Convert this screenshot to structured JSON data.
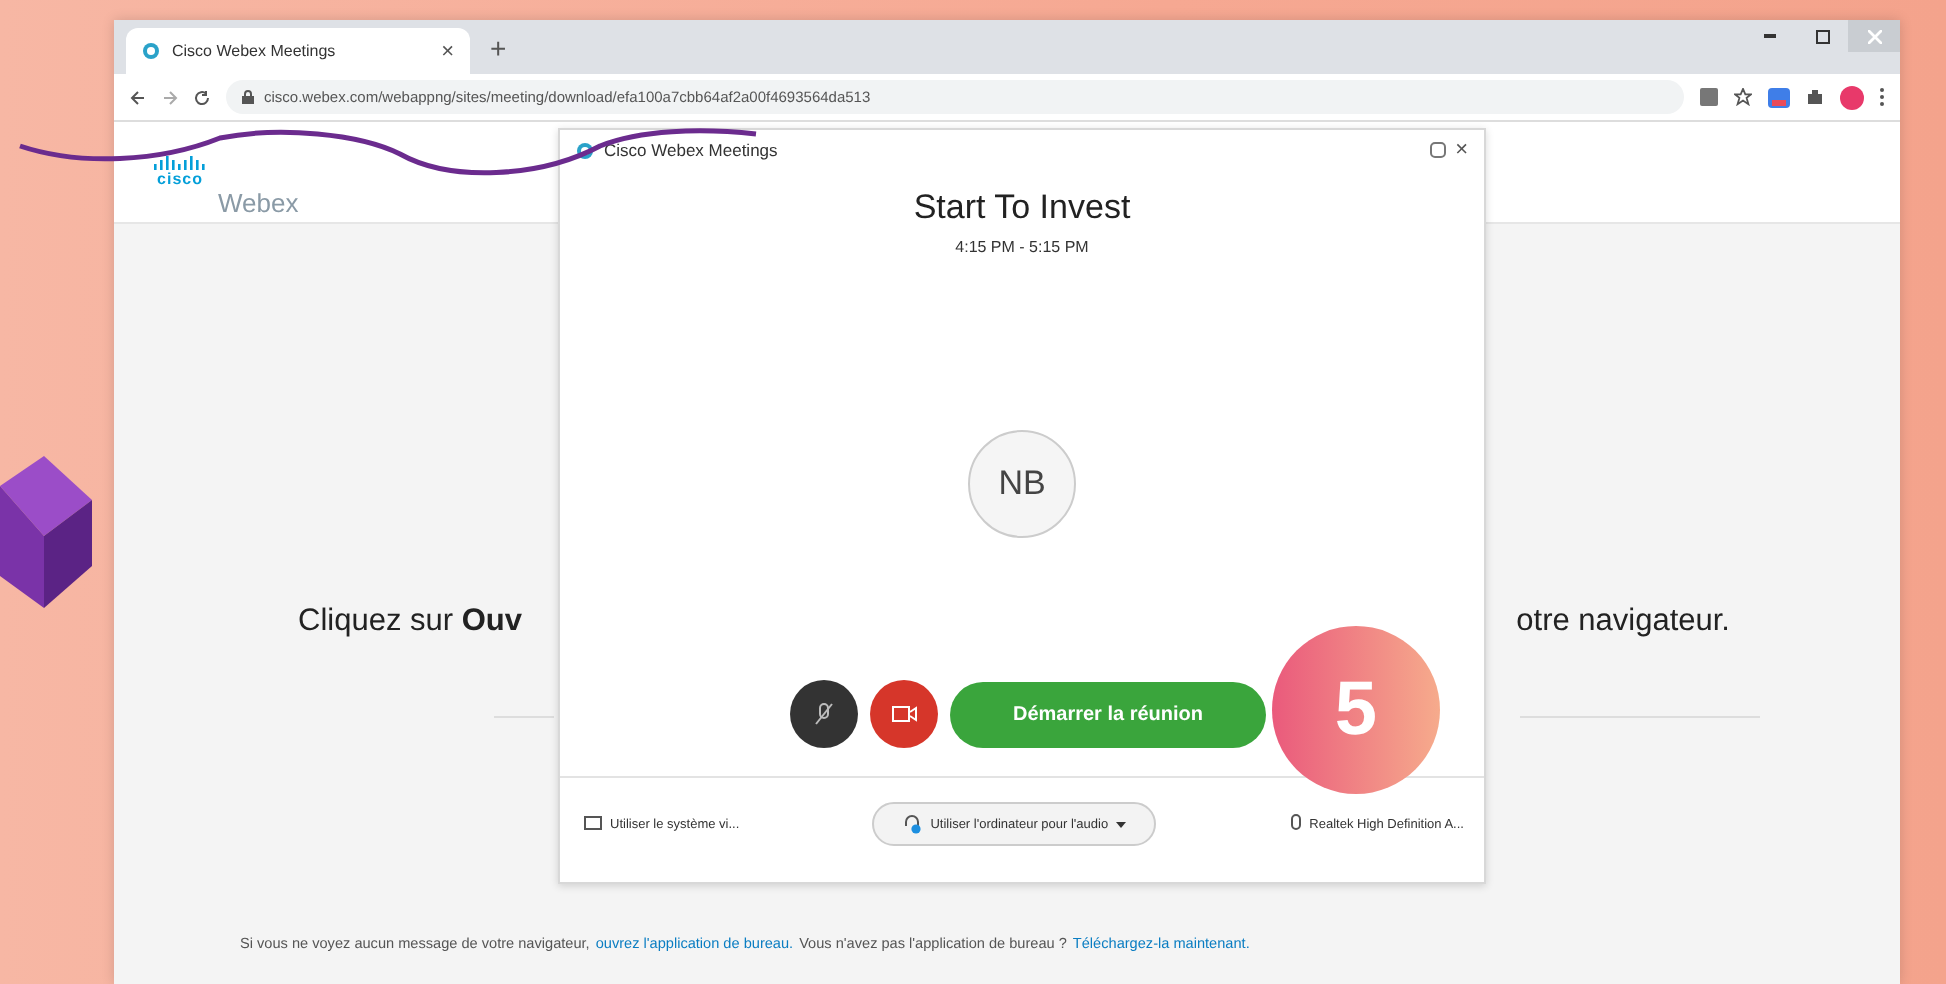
{
  "browser": {
    "tab": {
      "title": "Cisco Webex Meetings",
      "close": "×"
    },
    "new_tab": "+",
    "address": "cisco.webex.com/webappng/sites/meeting/download/efa100a7cbb64af2a00f4693564da513"
  },
  "page": {
    "logo": {
      "mark": "cisco",
      "name": "Webex"
    },
    "prompt_left": "Cliquez sur **Ouv**",
    "prompt_right": "otre navigateur.",
    "footer": [
      {
        "kind": "text",
        "text": "Si vous ne voyez aucun message de votre navigateur,"
      },
      {
        "kind": "link",
        "text": "ouvrez l'application de bureau."
      },
      {
        "kind": "text",
        "text": "Vous n'avez pas l'application de bureau ?"
      },
      {
        "kind": "link",
        "text": "Téléchargez-la maintenant."
      }
    ]
  },
  "dialog": {
    "title": "Cisco Webex Meetings",
    "close": "×",
    "meeting_title": "Start To Invest",
    "time": "4:15 PM - 5:15 PM",
    "avatar": "NB",
    "start_button": "Démarrer la réunion",
    "options": [
      {
        "kind": "video",
        "label": "Utiliser le système vi..."
      },
      {
        "kind": "audio",
        "label": "Utiliser l'ordinateur pour l'audio"
      },
      {
        "kind": "mic",
        "label": "Realtek High Definition A..."
      }
    ]
  },
  "step_badge": "5"
}
